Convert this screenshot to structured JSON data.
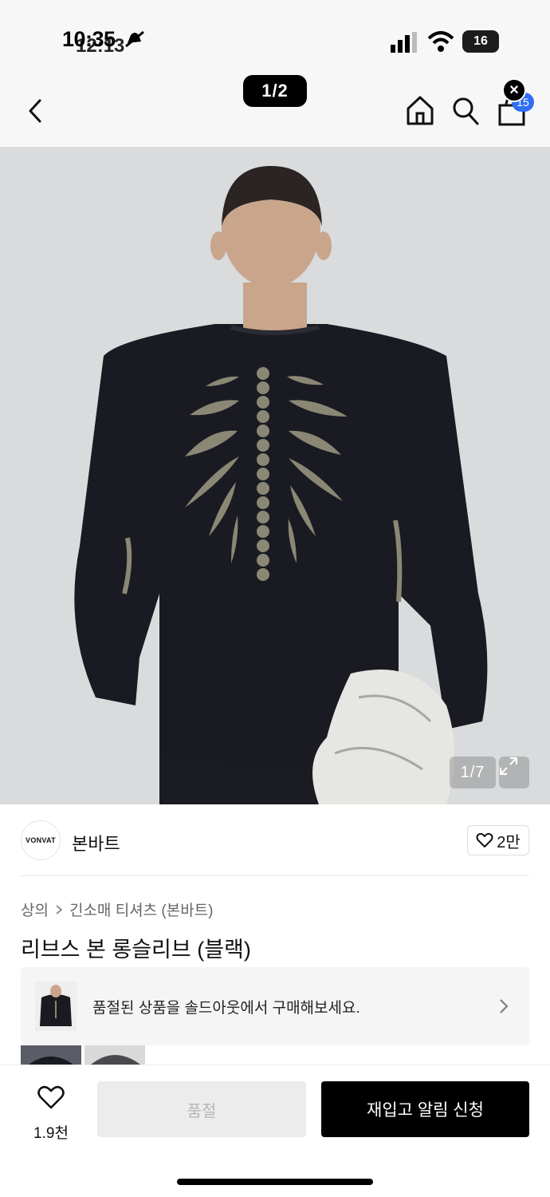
{
  "status_bar": {
    "time": "10:35",
    "time_overlay": "12:13",
    "battery": "16"
  },
  "header": {
    "page_indicator": "1/2",
    "cart_count": "15",
    "close_label": "×"
  },
  "hero": {
    "image_counter": "1/7"
  },
  "brand": {
    "logo_text": "VONVAT",
    "name": "본바트",
    "likes": "2만"
  },
  "breadcrumb": {
    "category": "상의",
    "subcategory": "긴소매 티셔츠 (본바트)"
  },
  "product": {
    "title": "리브스 본 롱슬리브 (블랙)"
  },
  "soldout_banner": {
    "text": "품절된 상품을 솔드아웃에서 구매해보세요."
  },
  "bottom_bar": {
    "wish_count": "1.9천",
    "soldout_label": "품절",
    "restock_label": "재입고 알림 신청"
  },
  "colors": {
    "accent_blue": "#2f6df6",
    "cta_black": "#000000",
    "disabled_gray": "#ececec"
  }
}
